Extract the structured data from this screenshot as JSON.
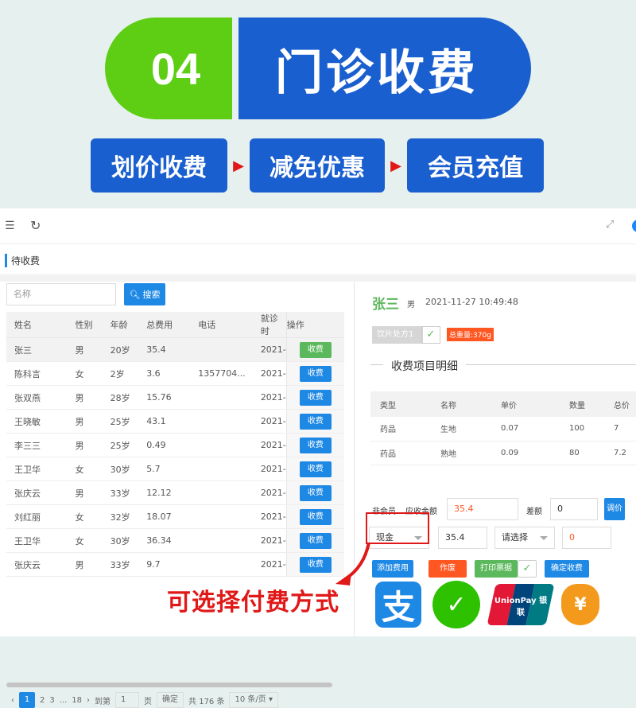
{
  "banner": {
    "number": "04",
    "title": "门诊收费",
    "steps": [
      "划价收费",
      "减免优惠",
      "会员充值"
    ]
  },
  "page": {
    "title": "待收费"
  },
  "search": {
    "placeholder": "名称",
    "button": "搜索"
  },
  "list": {
    "headers": [
      "姓名",
      "性别",
      "年龄",
      "总费用",
      "电话",
      "就诊时",
      "操作"
    ],
    "rows": [
      {
        "name": "张三",
        "sex": "男",
        "age": "20岁",
        "fee": "35.4",
        "phone": "",
        "date": "2021-",
        "op": "收费"
      },
      {
        "name": "陈科言",
        "sex": "女",
        "age": "2岁",
        "fee": "3.6",
        "phone": "1357704...",
        "date": "2021-",
        "op": "收费"
      },
      {
        "name": "张双燕",
        "sex": "男",
        "age": "28岁",
        "fee": "15.76",
        "phone": "",
        "date": "2021-",
        "op": "收费"
      },
      {
        "name": "王晓敏",
        "sex": "男",
        "age": "25岁",
        "fee": "43.1",
        "phone": "",
        "date": "2021-",
        "op": "收费"
      },
      {
        "name": "李三三",
        "sex": "男",
        "age": "25岁",
        "fee": "0.49",
        "phone": "",
        "date": "2021-",
        "op": "收费"
      },
      {
        "name": "王卫华",
        "sex": "女",
        "age": "30岁",
        "fee": "5.7",
        "phone": "",
        "date": "2021-",
        "op": "收费"
      },
      {
        "name": "张庆云",
        "sex": "男",
        "age": "33岁",
        "fee": "12.12",
        "phone": "",
        "date": "2021-",
        "op": "收费"
      },
      {
        "name": "刘红丽",
        "sex": "女",
        "age": "32岁",
        "fee": "18.07",
        "phone": "",
        "date": "2021-",
        "op": "收费"
      },
      {
        "name": "王卫华",
        "sex": "女",
        "age": "30岁",
        "fee": "36.34",
        "phone": "",
        "date": "2021-",
        "op": "收费"
      },
      {
        "name": "张庆云",
        "sex": "男",
        "age": "33岁",
        "fee": "9.7",
        "phone": "",
        "date": "2021-",
        "op": "收费"
      }
    ]
  },
  "pager": {
    "pages": [
      "1",
      "2",
      "3",
      "...",
      "18"
    ],
    "goto_label": "到第",
    "goto_value": "1",
    "page_unit": "页",
    "confirm": "确定",
    "total": "共 176 条",
    "page_size": "10 条/页"
  },
  "patient": {
    "name": "张三",
    "sex": "男",
    "time": "2021-11-27 10:49:48",
    "rx_tag": "饮片处方1",
    "total_badge": "总重量:370g"
  },
  "detail": {
    "title": "收费项目明细",
    "headers": [
      "类型",
      "名称",
      "单价",
      "数量",
      "总价"
    ],
    "rows": [
      {
        "type": "药品",
        "name": "生地",
        "price": "0.07",
        "qty": "100",
        "total": "7"
      },
      {
        "type": "药品",
        "name": "熟地",
        "price": "0.09",
        "qty": "80",
        "total": "7.2"
      }
    ]
  },
  "fee": {
    "member_label": "非会员",
    "due_label": "应收金额",
    "due_value": "35.4",
    "diff_label": "差额",
    "diff_value": "0",
    "adjust_btn": "调价",
    "pay_method": "现金",
    "pay_amount": "35.4",
    "second_select": "请选择",
    "second_amount": "0",
    "add_btn": "添加费用",
    "void_btn": "作废",
    "print_btn": "打印票据",
    "confirm_btn": "确定收费"
  },
  "callout": "可选择付费方式",
  "pay_icons": {
    "unionpay_text": "UnionPay 银联"
  },
  "colors": {
    "green": "#5ece14",
    "blue": "#1a5fcf",
    "red": "#e01818",
    "primary": "#1e88e5"
  }
}
